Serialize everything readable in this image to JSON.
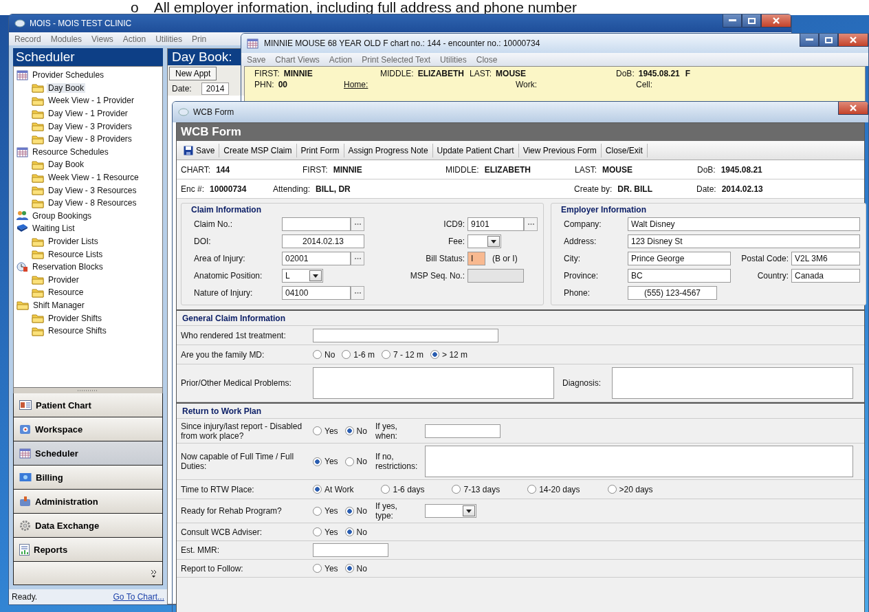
{
  "caption": {
    "bullet": "o",
    "text": "All employer information, including full address and phone number"
  },
  "main_window": {
    "title": "MOIS - MOIS TEST CLINIC",
    "menu": [
      "Record",
      "Modules",
      "Views",
      "Action",
      "Utilities",
      "Prin"
    ],
    "sidebar": {
      "title": "Scheduler",
      "tree": [
        {
          "label": "Provider Schedules",
          "kind": "calendar",
          "children": [
            {
              "label": "Day Book",
              "selected": true
            },
            {
              "label": "Week View - 1 Provider",
              "selected": false
            },
            {
              "label": "Day View - 1 Provider",
              "selected": false
            },
            {
              "label": "Day View - 3 Providers",
              "selected": false
            },
            {
              "label": "Day View - 8 Providers",
              "selected": false
            }
          ]
        },
        {
          "label": "Resource Schedules",
          "kind": "calendar",
          "children": [
            {
              "label": "Day Book",
              "selected": false
            },
            {
              "label": "Week View - 1 Resource",
              "selected": false
            },
            {
              "label": "Day View - 3 Resources",
              "selected": false
            },
            {
              "label": "Day View - 8 Resources",
              "selected": false
            }
          ]
        },
        {
          "label": "Group Bookings",
          "kind": "people"
        },
        {
          "label": "Waiting List",
          "kind": "book",
          "children": [
            {
              "label": "Provider Lists",
              "selected": false
            },
            {
              "label": "Resource Lists",
              "selected": false
            }
          ]
        },
        {
          "label": "Reservation Blocks",
          "kind": "clock",
          "children": [
            {
              "label": "Provider",
              "selected": false
            },
            {
              "label": "Resource",
              "selected": false
            }
          ]
        },
        {
          "label": "Shift Manager",
          "kind": "folder",
          "children": [
            {
              "label": "Provider Shifts",
              "selected": false
            },
            {
              "label": "Resource Shifts",
              "selected": false
            }
          ]
        }
      ],
      "nav": [
        {
          "label": "Patient Chart",
          "kind": "card",
          "selected": false
        },
        {
          "label": "Workspace",
          "kind": "cube",
          "selected": false
        },
        {
          "label": "Scheduler",
          "kind": "calendar",
          "selected": true
        },
        {
          "label": "Billing",
          "kind": "bill",
          "selected": false
        },
        {
          "label": "Administration",
          "kind": "admin",
          "selected": false
        },
        {
          "label": "Data Exchange",
          "kind": "gear",
          "selected": false
        },
        {
          "label": "Reports",
          "kind": "report",
          "selected": false
        }
      ]
    },
    "content": {
      "title": "Day Book:",
      "button": "New Appt",
      "date_label": "Date:",
      "date_value": "2014"
    },
    "status_bar": {
      "text": "Ready.",
      "link": "Go To Chart..."
    }
  },
  "chart_window": {
    "title": "MINNIE MOUSE 68 YEAR OLD F   chart no.: 144 -   encounter no.: 10000734",
    "menu": [
      "Save",
      "Chart Views",
      "Action",
      "Print Selected Text",
      "Utilities",
      "Close"
    ],
    "rows": [
      [
        {
          "kind": "field",
          "label": "FIRST:",
          "value": "MINNIE"
        },
        {
          "kind": "field",
          "label": "MIDDLE:",
          "value": "ELIZABETH"
        },
        {
          "kind": "field",
          "label": "LAST:",
          "value": "MOUSE"
        },
        {
          "kind": "field",
          "label": "DoB:",
          "value": "1945.08.21"
        },
        {
          "kind": "field",
          "value": "F"
        }
      ],
      [
        {
          "kind": "field",
          "label": "PHN:",
          "value": "00"
        },
        {
          "kind": "link",
          "label": "Home:"
        },
        {
          "kind": "field",
          "label": "Work:"
        },
        {
          "kind": "field",
          "label": "Cell:"
        }
      ]
    ]
  },
  "wcb_form": {
    "window_title": "WCB Form",
    "header": "WCB Form",
    "toolbar": [
      "Save",
      "Create MSP Claim",
      "Print Form",
      "Assign Progress Note",
      "Update Patient Chart",
      "View Previous Form",
      "Close/Exit"
    ],
    "patient_rows": [
      [
        {
          "label": "CHART:",
          "value": "144"
        },
        {
          "label": "FIRST:",
          "value": "MINNIE"
        },
        {
          "label": "MIDDLE:",
          "value": "ELIZABETH"
        },
        {
          "label": "LAST:",
          "value": "MOUSE"
        },
        {
          "label": "DoB:",
          "value": "1945.08.21"
        }
      ],
      [
        {
          "label": "Enc #:",
          "value": "10000734"
        },
        {
          "label": "Attending:",
          "value": "BILL, DR"
        },
        {
          "label": "Create by:",
          "value": "DR. BILL"
        },
        {
          "label": "Date:",
          "value": "2014.02.13"
        }
      ]
    ],
    "claim": {
      "title": "Claim Information",
      "left": [
        {
          "label": "Claim No.:",
          "kind": "lookup"
        },
        {
          "label": "DOI:",
          "kind": "centered",
          "value": "2014.02.13"
        },
        {
          "label": "Area of Injury:",
          "kind": "lookup",
          "value": "02001"
        },
        {
          "label": "Anatomic Position:",
          "kind": "select",
          "value": "L"
        },
        {
          "label": "Nature of Injury:",
          "kind": "lookup",
          "value": "04100"
        }
      ],
      "right": [
        {
          "label": "ICD9:",
          "kind": "lookup",
          "value": "9101"
        },
        {
          "label": "Fee:",
          "kind": "select"
        },
        {
          "label": "Bill Status:",
          "kind": "flagged",
          "value": "I",
          "suffix": "(B or I)"
        },
        {
          "label": "MSP Seq. No.:",
          "kind": "disabled"
        }
      ]
    },
    "employer": {
      "title": "Employer Information",
      "rows": [
        [
          {
            "label": "Company:",
            "value": "Walt Disney"
          }
        ],
        [
          {
            "label": "Address:",
            "value": "123 Disney St"
          }
        ],
        [
          {
            "label": "City:",
            "value": "Prince George"
          },
          {
            "label": "Postal Code:",
            "value": "V2L 3M6"
          }
        ],
        [
          {
            "label": "Province:",
            "value": "BC"
          },
          {
            "label": "Country:",
            "value": "Canada"
          }
        ],
        [
          {
            "label": "Phone:",
            "value": "(555) 123-4567",
            "kind": "centered"
          }
        ]
      ]
    },
    "sections": [
      {
        "title": "General Claim Information",
        "rows": [
          {
            "label": "Who rendered 1st treatment:",
            "parts": [
              {
                "kind": "wide-input"
              }
            ]
          },
          {
            "label": "Are you the family MD:",
            "parts": [
              {
                "kind": "radios",
                "options": [
                  {
                    "label": "No",
                    "selected": false
                  },
                  {
                    "label": "1-6 m",
                    "selected": false
                  },
                  {
                    "label": "7 - 12 m",
                    "selected": false
                  },
                  {
                    "label": "> 12 m",
                    "selected": true
                  }
                ]
              }
            ]
          },
          {
            "label": "Prior/Other Medical Problems:",
            "parts": [
              {
                "kind": "textarea"
              },
              {
                "kind": "label",
                "text": "Diagnosis:"
              },
              {
                "kind": "textarea"
              }
            ]
          }
        ]
      },
      {
        "title": "Return to Work Plan",
        "rows": [
          {
            "label": "Since injury/last report - Disabled from work place?",
            "parts": [
              {
                "kind": "radios",
                "options": [
                  {
                    "label": "Yes",
                    "selected": false
                  },
                  {
                    "label": "No",
                    "selected": true
                  }
                ]
              },
              {
                "kind": "label",
                "text": "If yes, when:"
              },
              {
                "kind": "input"
              }
            ]
          },
          {
            "label": "Now capable of Full Time / Full Duties:",
            "parts": [
              {
                "kind": "radios",
                "options": [
                  {
                    "label": "Yes",
                    "selected": true
                  },
                  {
                    "label": "No",
                    "selected": false
                  }
                ]
              },
              {
                "kind": "label",
                "text": "If no, restrictions:"
              },
              {
                "kind": "textarea"
              }
            ]
          },
          {
            "label": "Time to RTW Place:",
            "parts": [
              {
                "kind": "spread-radios",
                "options": [
                  {
                    "label": "At Work",
                    "selected": true
                  },
                  {
                    "label": "1-6 days",
                    "selected": false
                  },
                  {
                    "label": "7-13 days",
                    "selected": false
                  },
                  {
                    "label": "14-20 days",
                    "selected": false
                  },
                  {
                    "label": ">20 days",
                    "selected": false
                  }
                ]
              }
            ]
          },
          {
            "label": "Ready for Rehab Program?",
            "parts": [
              {
                "kind": "radios",
                "options": [
                  {
                    "label": "Yes",
                    "selected": false
                  },
                  {
                    "label": "No",
                    "selected": true
                  }
                ]
              },
              {
                "kind": "label",
                "text": "If yes, type:"
              },
              {
                "kind": "select"
              }
            ]
          },
          {
            "label": "Consult WCB Adviser:",
            "parts": [
              {
                "kind": "radios",
                "options": [
                  {
                    "label": "Yes",
                    "selected": false
                  },
                  {
                    "label": "No",
                    "selected": true
                  }
                ]
              }
            ]
          },
          {
            "label": "Est. MMR:",
            "parts": [
              {
                "kind": "input"
              }
            ]
          },
          {
            "label": "Report to Follow:",
            "parts": [
              {
                "kind": "radios",
                "options": [
                  {
                    "label": "Yes",
                    "selected": false
                  },
                  {
                    "label": "No",
                    "selected": true
                  }
                ]
              }
            ]
          }
        ]
      }
    ]
  }
}
